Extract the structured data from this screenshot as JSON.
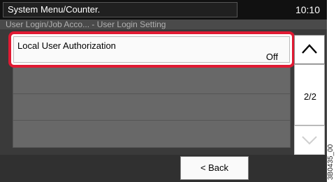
{
  "header": {
    "title": "System Menu/Counter.",
    "time": "10:10"
  },
  "breadcrumb": "User Login/Job Acco... - User Login Setting",
  "list": {
    "items": [
      {
        "label": "Local User Authorization",
        "value": "Off",
        "selected": true
      }
    ]
  },
  "pager": {
    "indicator": "2/2"
  },
  "footer": {
    "back_label": "< Back"
  },
  "doc_id": "3B0435_00",
  "colors": {
    "highlight": "#e01a33"
  },
  "icons": {
    "up": "chevron-up-icon",
    "down": "chevron-down-icon"
  }
}
